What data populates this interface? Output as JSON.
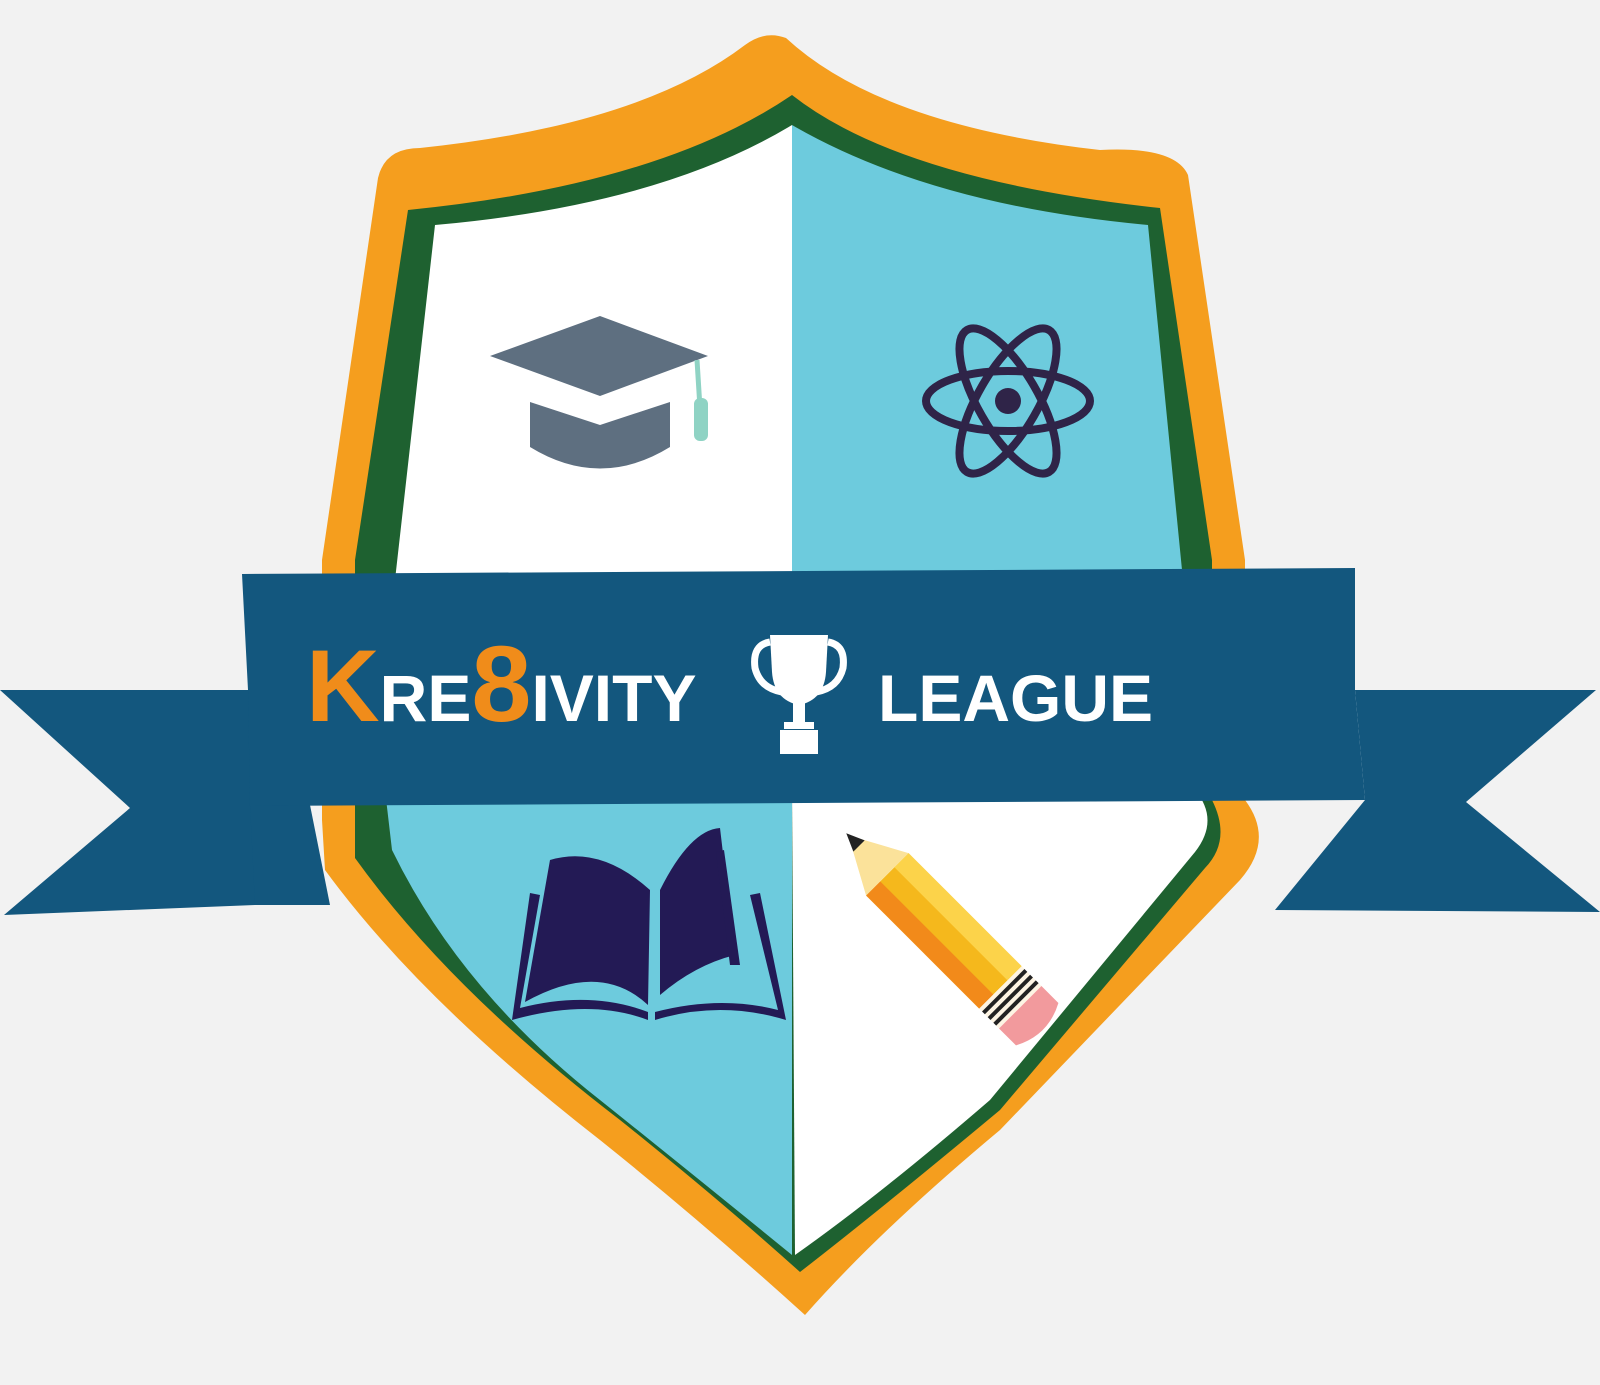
{
  "logo": {
    "name_parts": {
      "initial": "K",
      "part1": "RE",
      "digit": "8",
      "part2": "IVITY",
      "suffix": "LEAGUE"
    },
    "full_text": "KRE8IVITY LEAGUE"
  },
  "icons": [
    "graduation-cap-icon",
    "atom-icon",
    "trophy-icon",
    "open-book-icon",
    "pencil-icon"
  ],
  "colors": {
    "background": "#f2f2f2",
    "shield_outer": "#f59e1e",
    "shield_border": "#1e6130",
    "shield_light": "#6dcbdd",
    "shield_white": "#ffffff",
    "banner": "#13577e",
    "accent_orange": "#f08c1a",
    "text_white": "#ffffff",
    "cap": "#5e6f80",
    "atom": "#2f2448",
    "book": "#231a55"
  }
}
